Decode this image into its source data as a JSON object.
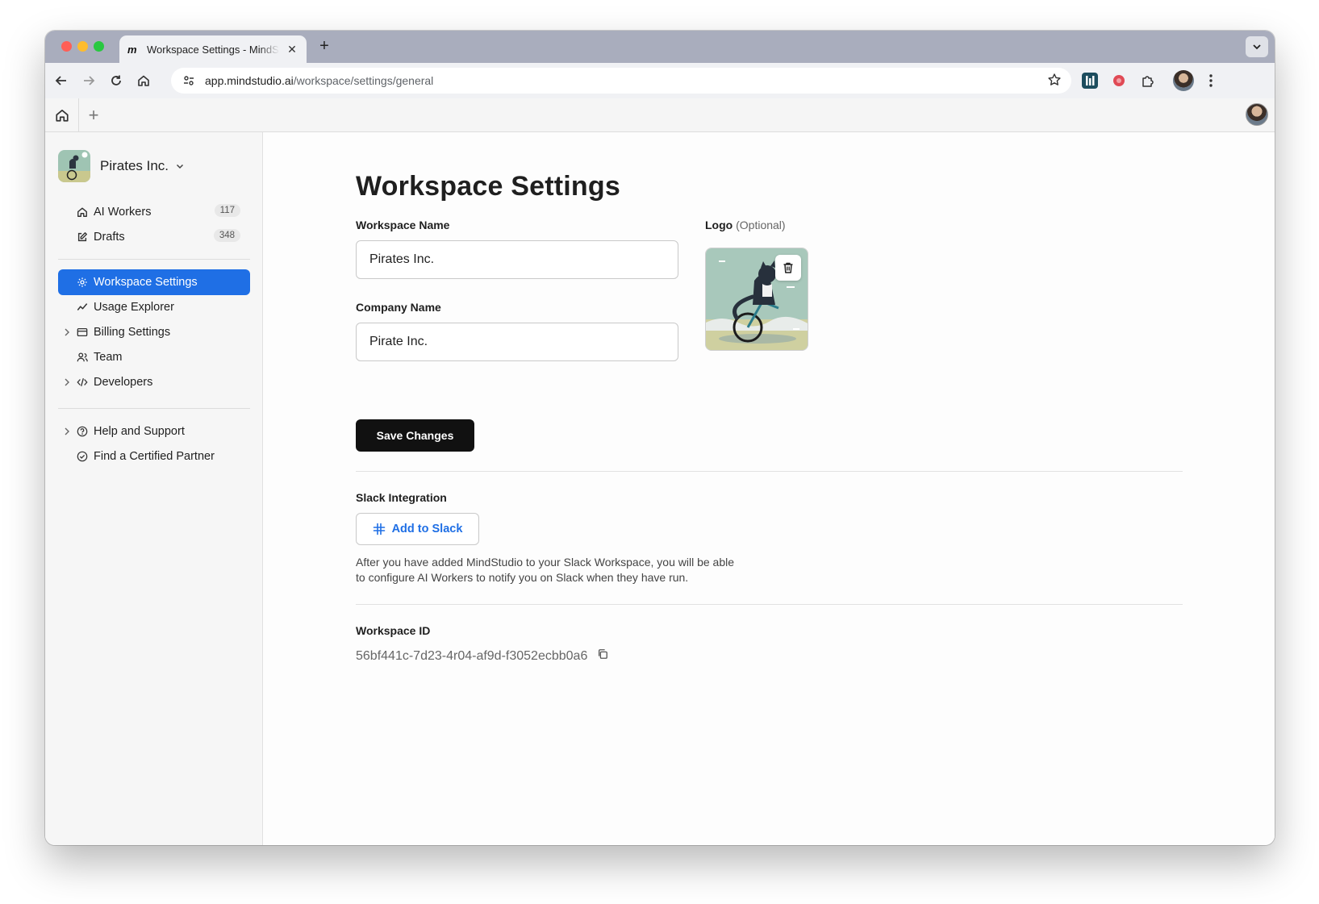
{
  "browser": {
    "tab_title": "Workspace Settings - MindStudio",
    "tab_favicon": "m",
    "url_host": "app.mindstudio.ai",
    "url_path": "/workspace/settings/general"
  },
  "sidebar": {
    "workspace_name": "Pirates Inc.",
    "items": [
      {
        "label": "AI Workers",
        "count": "117",
        "icon": "home-icon"
      },
      {
        "label": "Drafts",
        "count": "348",
        "icon": "edit-icon"
      },
      {
        "label": "Workspace Settings",
        "icon": "gear-icon",
        "active": true
      },
      {
        "label": "Usage Explorer",
        "icon": "trend-icon"
      },
      {
        "label": "Billing Settings",
        "icon": "card-icon",
        "expandable": true
      },
      {
        "label": "Team",
        "icon": "users-icon"
      },
      {
        "label": "Developers",
        "icon": "code-icon",
        "expandable": true
      },
      {
        "label": "Help and Support",
        "icon": "help-icon",
        "expandable": true
      },
      {
        "label": "Find a Certified Partner",
        "icon": "badge-check-icon"
      }
    ]
  },
  "main": {
    "title": "Workspace Settings",
    "workspace_name_label": "Workspace Name",
    "workspace_name_value": "Pirates Inc.",
    "company_name_label": "Company Name",
    "company_name_value": "Pirate Inc.",
    "logo_label": "Logo",
    "logo_optional": "(Optional)",
    "save_label": "Save Changes",
    "slack_label": "Slack Integration",
    "slack_button": "Add to Slack",
    "slack_desc_line1": "After you have added MindStudio to your Slack Workspace, you will be able",
    "slack_desc_line2": "to configure AI Workers to notify you on Slack when they have run.",
    "workspace_id_label": "Workspace ID",
    "workspace_id": "56bf441c-7d23-4r04-af9d-f3052ecbb0a6"
  },
  "colors": {
    "accent": "#1f6fe5",
    "primary_button": "#111111"
  }
}
